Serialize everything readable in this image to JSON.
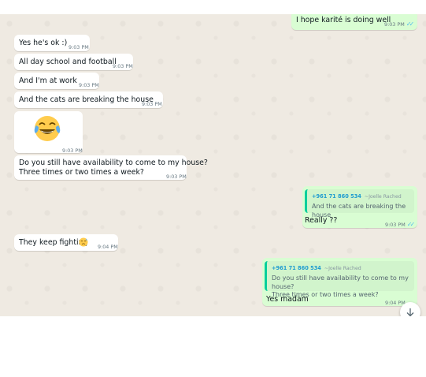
{
  "messages": {
    "m0": {
      "text": "I hope karité is doing well",
      "time": "9:03 PM",
      "ticks": "✓✓"
    },
    "m1": {
      "text": "Yes he's ok :)",
      "time": "9:03 PM"
    },
    "m2": {
      "text": "All day school and football",
      "time": "9:03 PM"
    },
    "m3": {
      "text": "And I'm at work",
      "time": "9:03 PM"
    },
    "m4": {
      "text": "And the cats are breaking the house",
      "time": "9:03 PM"
    },
    "m5": {
      "emoji": "face-with-tears-of-joy",
      "time": "9:03 PM"
    },
    "m6": {
      "line1": "Do you still have availability to come to my house?",
      "line2": "Three times or two times a week?",
      "time": "9:03 PM"
    },
    "m7": {
      "quote_name": "+961 71 860 534",
      "quote_push": "~Joelle Rached",
      "quote_text": "And the cats are breaking the house",
      "text": "Really ??",
      "time": "9:03 PM",
      "ticks": "✓✓"
    },
    "m8": {
      "text": "They keep fighting",
      "emoji": "downcast-face-with-sweat",
      "time": "9:04 PM"
    },
    "m9": {
      "quote_name": "+961 71 860 534",
      "quote_push": "~Joelle Rached",
      "quote_line1": "Do you still have availability to come to my house?",
      "quote_line2": "Three times or two times a week?",
      "text": "Yes madam",
      "time": "9:04 PM"
    }
  },
  "colors": {
    "chat_bg": "#efeae2",
    "incoming": "#ffffff",
    "outgoing": "#d9fdd3",
    "tick_read": "#53bdeb",
    "quote_bar": "#06cf9c",
    "quote_name": "#1f9bd0"
  },
  "scroll_button_icon": "arrow-down-icon"
}
